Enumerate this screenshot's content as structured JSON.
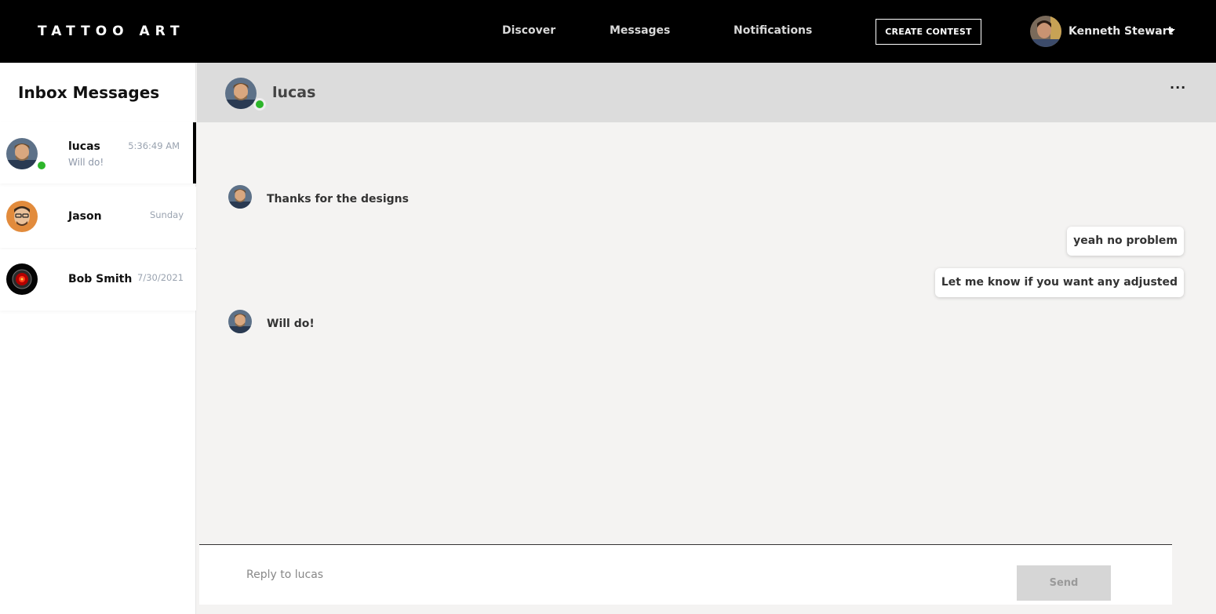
{
  "app": {
    "logo": "TATTOO ART"
  },
  "nav": {
    "links": [
      "Discover",
      "Messages",
      "Notifications"
    ],
    "create_contest": "CREATE CONTEST",
    "user_name": "Kenneth Stewart",
    "dropdown_icon": "caret-down-icon"
  },
  "sidebar": {
    "title": "Inbox Messages",
    "conversations": [
      {
        "name": "lucas",
        "time": "5:36:49 AM",
        "preview": "Will do!",
        "online": true,
        "active": true
      },
      {
        "name": "Jason",
        "time": "Sunday",
        "preview": "",
        "online": false,
        "active": false
      },
      {
        "name": "Bob Smith",
        "time": "7/30/2021",
        "preview": "",
        "online": false,
        "active": false
      }
    ]
  },
  "chat": {
    "header_name": "lucas",
    "more_icon": "more-dots-icon",
    "messages": [
      {
        "direction": "in",
        "text": "Thanks for the designs"
      },
      {
        "direction": "out",
        "text": "yeah no problem"
      },
      {
        "direction": "out",
        "text": "Let me know if you want any adjusted"
      },
      {
        "direction": "in",
        "text": "Will do!"
      }
    ],
    "reply_placeholder": "Reply to lucas",
    "send_label": "Send"
  },
  "colors": {
    "online": "#2db52a",
    "topbar": "#000000",
    "header_bg": "#dcdcdc"
  }
}
